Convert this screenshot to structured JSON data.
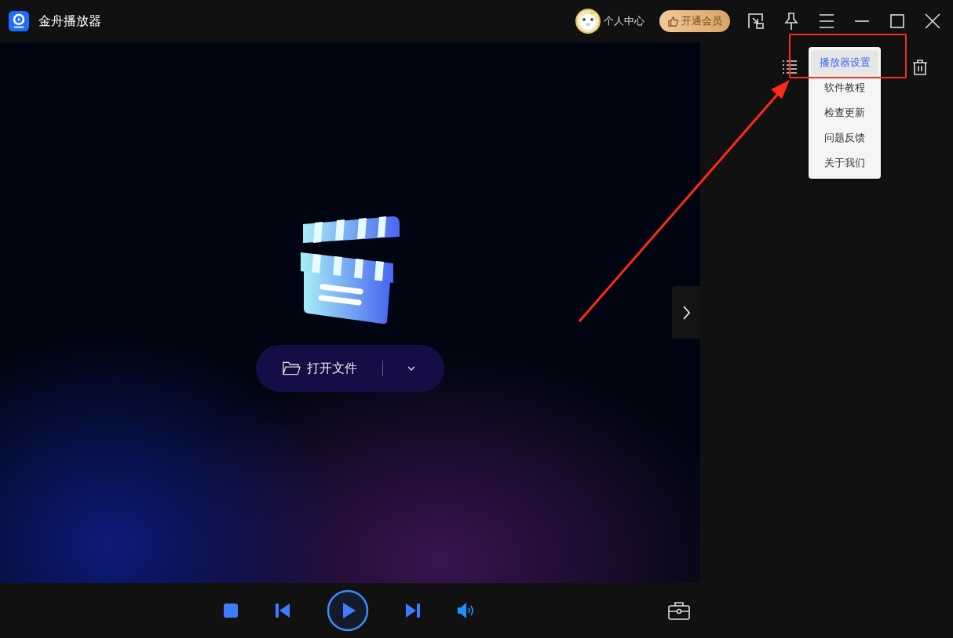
{
  "title_bar": {
    "app_name": "金舟播放器",
    "user_center": "个人中心",
    "vip_button": "开通会员"
  },
  "open_file": {
    "label": "打开文件"
  },
  "menu": {
    "items": [
      {
        "label": "播放器设置",
        "selected": true
      },
      {
        "label": "软件教程",
        "selected": false
      },
      {
        "label": "检查更新",
        "selected": false
      },
      {
        "label": "问题反馈",
        "selected": false
      },
      {
        "label": "关于我们",
        "selected": false
      }
    ]
  }
}
